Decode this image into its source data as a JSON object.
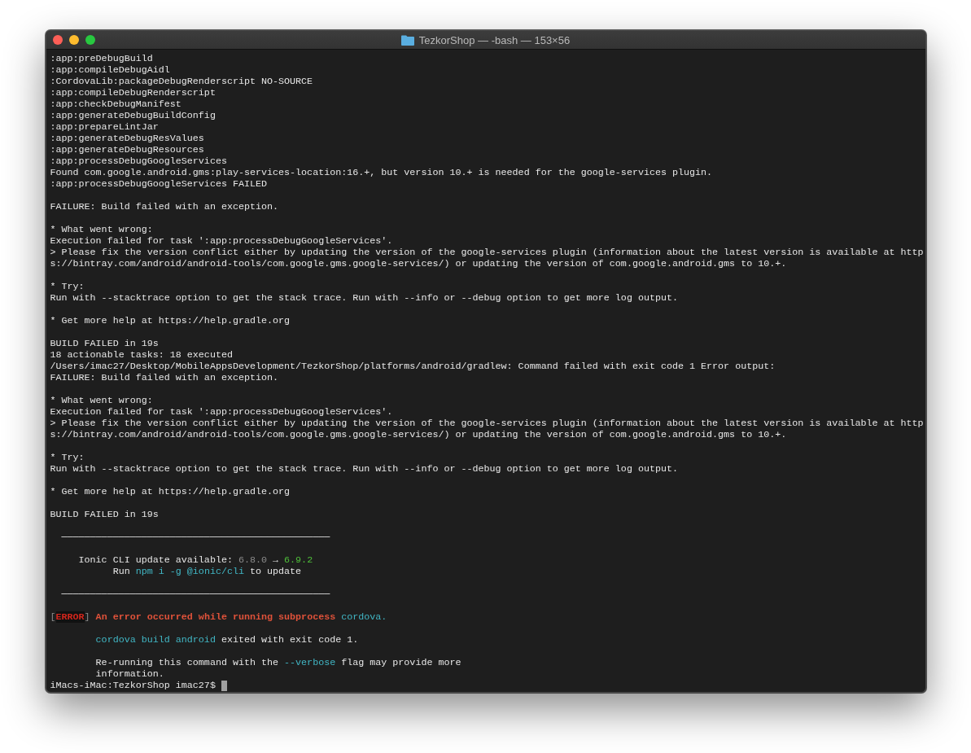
{
  "window": {
    "title": "TezkorShop — -bash — 153×56"
  },
  "terminal": {
    "lines": [
      {
        "segments": [
          {
            "kind": "plain",
            "text": ":app:preDebugBuild"
          }
        ]
      },
      {
        "segments": [
          {
            "kind": "plain",
            "text": ":app:compileDebugAidl"
          }
        ]
      },
      {
        "segments": [
          {
            "kind": "plain",
            "text": ":CordovaLib:packageDebugRenderscript NO-SOURCE"
          }
        ]
      },
      {
        "segments": [
          {
            "kind": "plain",
            "text": ":app:compileDebugRenderscript"
          }
        ]
      },
      {
        "segments": [
          {
            "kind": "plain",
            "text": ":app:checkDebugManifest"
          }
        ]
      },
      {
        "segments": [
          {
            "kind": "plain",
            "text": ":app:generateDebugBuildConfig"
          }
        ]
      },
      {
        "segments": [
          {
            "kind": "plain",
            "text": ":app:prepareLintJar"
          }
        ]
      },
      {
        "segments": [
          {
            "kind": "plain",
            "text": ":app:generateDebugResValues"
          }
        ]
      },
      {
        "segments": [
          {
            "kind": "plain",
            "text": ":app:generateDebugResources"
          }
        ]
      },
      {
        "segments": [
          {
            "kind": "plain",
            "text": ":app:processDebugGoogleServices"
          }
        ]
      },
      {
        "segments": [
          {
            "kind": "plain",
            "text": "Found com.google.android.gms:play-services-location:16.+, but version 10.+ is needed for the google-services plugin."
          }
        ]
      },
      {
        "segments": [
          {
            "kind": "plain",
            "text": ":app:processDebugGoogleServices FAILED"
          }
        ]
      },
      {
        "blank": true
      },
      {
        "segments": [
          {
            "kind": "plain",
            "text": "FAILURE: Build failed with an exception."
          }
        ]
      },
      {
        "blank": true
      },
      {
        "segments": [
          {
            "kind": "plain",
            "text": "* What went wrong:"
          }
        ]
      },
      {
        "segments": [
          {
            "kind": "plain",
            "text": "Execution failed for task ':app:processDebugGoogleServices'."
          }
        ]
      },
      {
        "segments": [
          {
            "kind": "plain",
            "text": "> Please fix the version conflict either by updating the version of the google-services plugin (information about the latest version is available at http"
          }
        ]
      },
      {
        "segments": [
          {
            "kind": "plain",
            "text": "s://bintray.com/android/android-tools/com.google.gms.google-services/) or updating the version of com.google.android.gms to 10.+."
          }
        ]
      },
      {
        "blank": true
      },
      {
        "segments": [
          {
            "kind": "plain",
            "text": "* Try:"
          }
        ]
      },
      {
        "segments": [
          {
            "kind": "plain",
            "text": "Run with --stacktrace option to get the stack trace. Run with --info or --debug option to get more log output."
          }
        ]
      },
      {
        "blank": true
      },
      {
        "segments": [
          {
            "kind": "plain",
            "text": "* Get more help at https://help.gradle.org"
          }
        ]
      },
      {
        "blank": true
      },
      {
        "segments": [
          {
            "kind": "plain",
            "text": "BUILD FAILED in 19s"
          }
        ]
      },
      {
        "segments": [
          {
            "kind": "plain",
            "text": "18 actionable tasks: 18 executed"
          }
        ]
      },
      {
        "segments": [
          {
            "kind": "plain",
            "text": "/Users/imac27/Desktop/MobileAppsDevelopment/TezkorShop/platforms/android/gradlew: Command failed with exit code 1 Error output:"
          }
        ]
      },
      {
        "segments": [
          {
            "kind": "plain",
            "text": "FAILURE: Build failed with an exception."
          }
        ]
      },
      {
        "blank": true
      },
      {
        "segments": [
          {
            "kind": "plain",
            "text": "* What went wrong:"
          }
        ]
      },
      {
        "segments": [
          {
            "kind": "plain",
            "text": "Execution failed for task ':app:processDebugGoogleServices'."
          }
        ]
      },
      {
        "segments": [
          {
            "kind": "plain",
            "text": "> Please fix the version conflict either by updating the version of the google-services plugin (information about the latest version is available at http"
          }
        ]
      },
      {
        "segments": [
          {
            "kind": "plain",
            "text": "s://bintray.com/android/android-tools/com.google.gms.google-services/) or updating the version of com.google.android.gms to 10.+."
          }
        ]
      },
      {
        "blank": true
      },
      {
        "segments": [
          {
            "kind": "plain",
            "text": "* Try:"
          }
        ]
      },
      {
        "segments": [
          {
            "kind": "plain",
            "text": "Run with --stacktrace option to get the stack trace. Run with --info or --debug option to get more log output."
          }
        ]
      },
      {
        "blank": true
      },
      {
        "segments": [
          {
            "kind": "plain",
            "text": "* Get more help at https://help.gradle.org"
          }
        ]
      },
      {
        "blank": true
      },
      {
        "segments": [
          {
            "kind": "plain",
            "text": "BUILD FAILED in 19s"
          }
        ]
      },
      {
        "blank": true
      },
      {
        "segments": [
          {
            "kind": "rule",
            "text": "  ───────────────────────────────────────────────"
          }
        ]
      },
      {
        "blank": true
      },
      {
        "segments": [
          {
            "kind": "plain",
            "text": "     Ionic CLI update available:"
          },
          {
            "kind": "dim",
            "text": " 6.8.0"
          },
          {
            "kind": "plain",
            "text": " →"
          },
          {
            "kind": "green",
            "text": " 6.9.2"
          }
        ]
      },
      {
        "segments": [
          {
            "kind": "plain",
            "text": "           Run"
          },
          {
            "kind": "cyan",
            "text": " npm i -g @ionic/cli"
          },
          {
            "kind": "plain",
            "text": " to update"
          }
        ]
      },
      {
        "blank": true
      },
      {
        "segments": [
          {
            "kind": "rule",
            "text": "  ───────────────────────────────────────────────"
          }
        ]
      },
      {
        "blank": true
      },
      {
        "segments": [
          {
            "kind": "dim",
            "text": "["
          },
          {
            "kind": "badge",
            "text": "ERROR"
          },
          {
            "kind": "dim",
            "text": "]"
          },
          {
            "kind": "error",
            "text": " An error occurred while running subprocess"
          },
          {
            "kind": "cyan",
            "text": " cordova."
          }
        ]
      },
      {
        "blank": true
      },
      {
        "segments": [
          {
            "kind": "cyan",
            "text": "        cordova build android"
          },
          {
            "kind": "plain",
            "text": " exited with exit code 1."
          }
        ]
      },
      {
        "blank": true
      },
      {
        "segments": [
          {
            "kind": "plain",
            "text": "        Re-running this command with the"
          },
          {
            "kind": "cyan",
            "text": " --verbose"
          },
          {
            "kind": "plain",
            "text": " flag may provide more"
          }
        ]
      },
      {
        "segments": [
          {
            "kind": "plain",
            "text": "        information."
          }
        ]
      },
      {
        "segments": [
          {
            "kind": "plain",
            "text": "iMacs-iMac:TezkorShop imac27$"
          }
        ],
        "cursor": true
      }
    ]
  }
}
